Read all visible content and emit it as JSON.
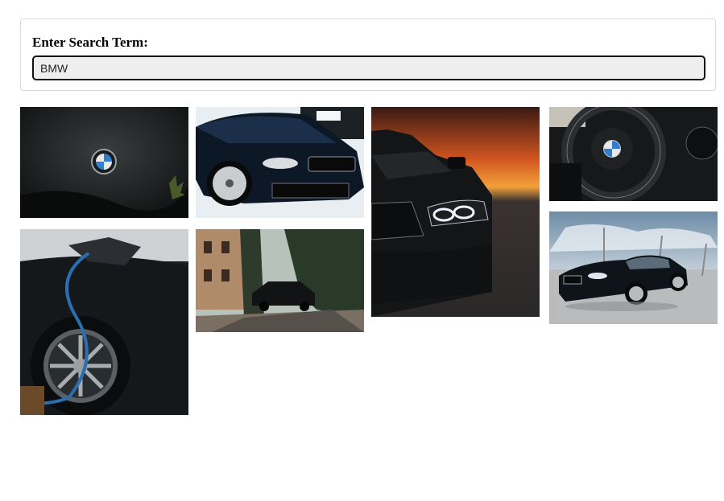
{
  "search": {
    "label": "Enter Search Term:",
    "value": "BMW"
  },
  "results": {
    "images": [
      {
        "subject": "bmw-emblem-wet-hood"
      },
      {
        "subject": "bmw-m-front-grille"
      },
      {
        "subject": "bmw-headlight-sunset"
      },
      {
        "subject": "bmw-steering-wheel"
      },
      {
        "subject": "bmw-ev-charging"
      },
      {
        "subject": "bmw-suv-village-road"
      },
      {
        "subject": "bmw-coupe-parking-lot"
      }
    ]
  }
}
